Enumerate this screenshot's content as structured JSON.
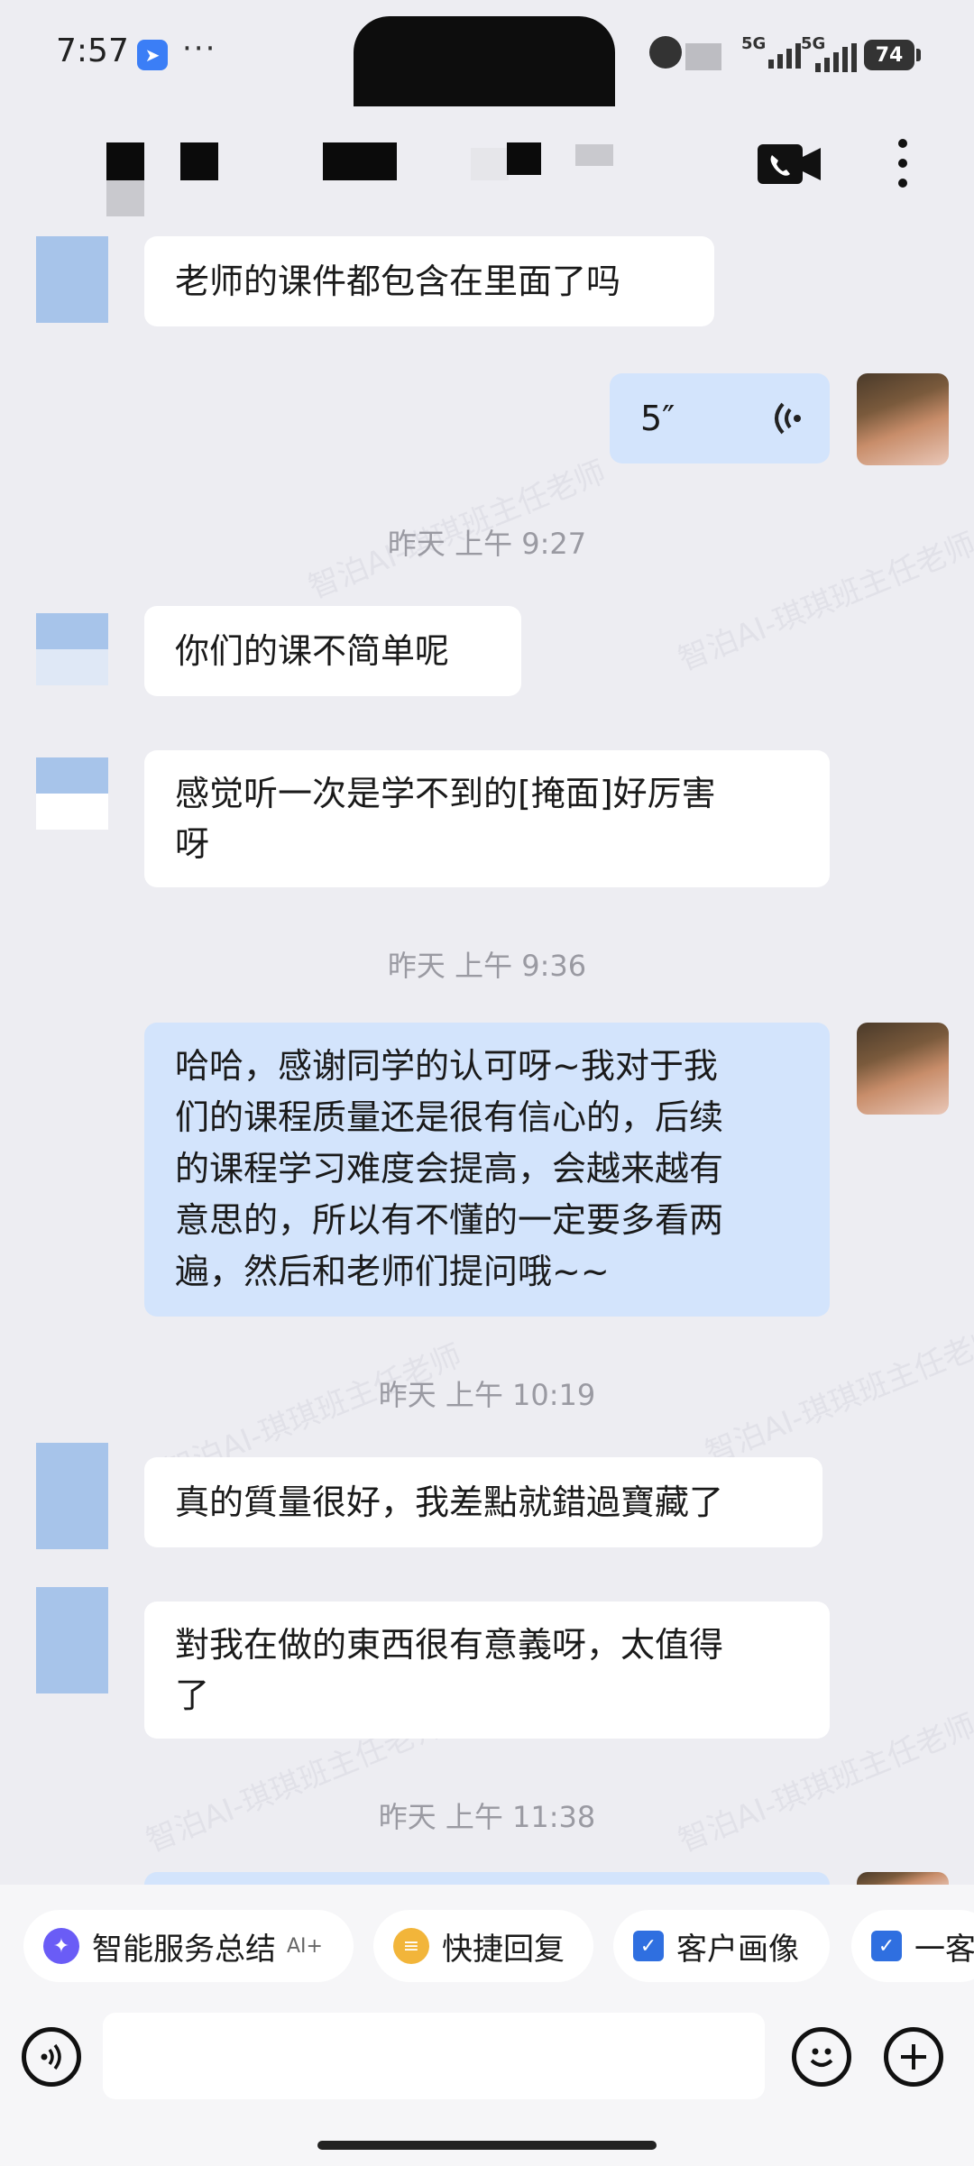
{
  "status_bar": {
    "time": "7:57",
    "app_icon": "feishu-plane-icon",
    "dots": "···",
    "network1": "5G",
    "network2": "5G",
    "battery": "74"
  },
  "header": {
    "title_redacted": true,
    "video_call_icon": "video-call-icon",
    "more_icon": "more-vertical-icon"
  },
  "messages": [
    {
      "side": "in",
      "lines": [
        "老师的课件都包含在里面了吗"
      ]
    },
    {
      "side": "out",
      "type": "voice",
      "duration": "5″",
      "voice_icon": "voice-wave-icon"
    },
    {
      "timestamp": "昨天  上午 9:27"
    },
    {
      "side": "in",
      "lines": [
        "你们的课不简单呢"
      ]
    },
    {
      "side": "in",
      "lines": [
        "感觉听一次是学不到的[掩面]好厉害",
        "呀"
      ]
    },
    {
      "timestamp": "昨天  上午 9:36"
    },
    {
      "side": "out",
      "lines": [
        "哈哈，感谢同学的认可呀~我对于我",
        "们的课程质量还是很有信心的，后续",
        "的课程学习难度会提高，会越来越有",
        "意思的，所以有不懂的一定要多看两",
        "遍，然后和老师们提问哦~~"
      ]
    },
    {
      "timestamp": "昨天  上午 10:19"
    },
    {
      "side": "in",
      "lines": [
        "真的質量很好，我差點就錯過寶藏了"
      ]
    },
    {
      "side": "in",
      "lines": [
        "對我在做的東西很有意義呀，太值得",
        "了"
      ]
    },
    {
      "timestamp": "昨天  上午 11:38"
    }
  ],
  "watermark": "智泊AI-琪琪班主任老师",
  "quick_actions": [
    {
      "label": "智能服务总结",
      "tag": "AI+",
      "icon": "ai-sparkle-icon",
      "color": "#6a5cf6"
    },
    {
      "label": "快捷回复",
      "icon": "quick-reply-icon",
      "color": "#f2b53a"
    },
    {
      "label": "客户画像",
      "icon": "checkbox-icon",
      "color": "#2f6fe0"
    },
    {
      "label": "一客",
      "icon": "checkbox-icon",
      "color": "#2f6fe0"
    }
  ],
  "input": {
    "placeholder": "",
    "voice_icon": "voice-input-icon",
    "emoji_icon": "emoji-icon",
    "plus_icon": "plus-icon"
  }
}
